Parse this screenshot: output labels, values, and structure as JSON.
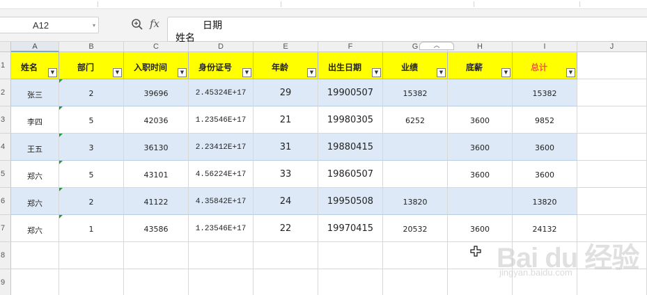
{
  "formula_bar": {
    "name_box": "A12",
    "fx_label": "fx",
    "content_line1": "日期",
    "content_line2": "姓名"
  },
  "columns": [
    "A",
    "B",
    "C",
    "D",
    "E",
    "F",
    "G",
    "H",
    "I",
    "J"
  ],
  "rows": [
    "1",
    "2",
    "3",
    "4",
    "5",
    "6",
    "7",
    "8",
    "9"
  ],
  "table": {
    "headers": [
      "姓名",
      "部门",
      "入职时间",
      "身份证号",
      "年龄",
      "出生日期",
      "业绩",
      "底薪",
      "总计"
    ],
    "header_color": "#ffff00",
    "total_header_color": "#ff4d4d",
    "band_color": "#dde9f6",
    "data": [
      [
        "张三",
        "2",
        "39696",
        "2.45324E+17",
        "29",
        "19900507",
        "15382",
        "",
        "15382"
      ],
      [
        "李四",
        "5",
        "42036",
        "1.23546E+17",
        "21",
        "19980305",
        "6252",
        "3600",
        "9852"
      ],
      [
        "王五",
        "3",
        "36130",
        "2.23412E+17",
        "31",
        "19880415",
        "",
        "3600",
        "3600"
      ],
      [
        "郑六",
        "5",
        "43101",
        "4.56224E+17",
        "33",
        "19860507",
        "",
        "3600",
        "3600"
      ],
      [
        "郑六",
        "2",
        "41122",
        "4.35842E+17",
        "24",
        "19950508",
        "13820",
        "",
        "13820"
      ],
      [
        "郑六",
        "1",
        "43586",
        "1.23546E+17",
        "22",
        "19970415",
        "20532",
        "3600",
        "24132"
      ]
    ]
  },
  "watermark": {
    "main": "Bai du 经验",
    "sub": "jingyan.baidu.com"
  }
}
